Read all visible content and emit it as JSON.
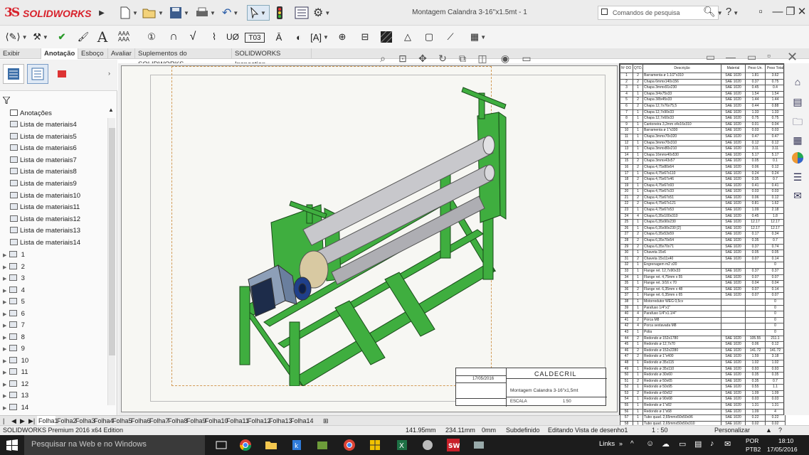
{
  "app": {
    "logo_ds": "3S",
    "logo_name": "SOLIDWORKS",
    "document_title": "Montagem Calandra 3-16''x1.5mt - 1",
    "search_placeholder": "Comandos de pesquisa",
    "help_label": "?",
    "window_controls": {
      "minimize": "—",
      "restore": "❐",
      "close": "✕"
    }
  },
  "ribbon_tabs": [
    {
      "label": "Exibir layout"
    },
    {
      "label": "Anotação",
      "active": true
    },
    {
      "label": "Esboço"
    },
    {
      "label": "Avaliar"
    },
    {
      "label": "Suplementos do SOLIDWORKS"
    },
    {
      "label": "SOLIDWORKS Inspection"
    }
  ],
  "annotation_tools": {
    "text_label": "A",
    "aaa_top": "AAA",
    "aaa_bottom": "AAA",
    "hole_callout": "UØ",
    "tag": "Τ03"
  },
  "left_panel": {
    "annotations_label": "Anotações",
    "bom_items": [
      "Lista de materiais4",
      "Lista de materiais5",
      "Lista de materiais6",
      "Lista de materiais7",
      "Lista de materiais8",
      "Lista de materiais9",
      "Lista de materiais10",
      "Lista de materiais11",
      "Lista de materiais12",
      "Lista de materiais13",
      "Lista de materiais14"
    ],
    "views": [
      "1",
      "2",
      "3",
      "4",
      "5",
      "6",
      "7",
      "8",
      "9",
      "10",
      "11",
      "12",
      "13",
      "14"
    ]
  },
  "sheet_tabs": [
    "Folha1",
    "Folha2",
    "Folha3",
    "Folha4",
    "Folha5",
    "Folha6",
    "Folha7",
    "Folha8",
    "Folha9",
    "Folha10",
    "Folha11",
    "Folha12",
    "Folha13",
    "Folha14"
  ],
  "title_block": {
    "company": "CALDECRIL",
    "title": "Montagem Calandra 3-16\"x1,5mt",
    "scale_label": "ESCALA",
    "scale": "1:50",
    "date": "17/05/2016"
  },
  "bom": {
    "headers": [
      "Nº DO ITEM",
      "QTD.",
      "Descrição",
      "Material",
      "Peso Un.",
      "Peso Total"
    ],
    "rows": [
      [
        "1",
        "2",
        "Barramenta ø 1.1/2\"x310",
        "SAE 1020",
        "1.81",
        "3.62"
      ],
      [
        "2",
        "2",
        "Chapa 6mmx140x156",
        "SAE 1020",
        "0.37",
        "0.75"
      ],
      [
        "3",
        "1",
        "Chapa 3mmx91x230",
        "SAE 1020",
        "0.45",
        "0.4"
      ],
      [
        "4",
        "1",
        "Chapa 3/4x75x33",
        "SAE 1020",
        "1.54",
        "1.54"
      ],
      [
        "5",
        "2",
        "Chapa 3/8x45x33",
        "SAE 1020",
        "1.44",
        "1.44"
      ],
      [
        "6",
        "2",
        "Chapa 12,7x76x75,5",
        "SAE 1020",
        "0.44",
        "0.88"
      ],
      [
        "7",
        "1",
        "Chapa 12,7x90x33",
        "SAE 1020",
        "1.33",
        "1.33"
      ],
      [
        "8",
        "1",
        "Chapa 12,7x60x33",
        "SAE 1020",
        "0.75",
        "0.75"
      ],
      [
        "9",
        "1",
        "Cantoneira 3,2mm x4x16x310",
        "SAE 1020",
        "0.01",
        "0.04"
      ],
      [
        "10",
        "1",
        "Barramenta ø 1\"x330",
        "SAE 1020",
        "0.03",
        "0.03"
      ],
      [
        "11",
        "1",
        "Chapa 3mmx70x320",
        "SAE 1020",
        "0.47",
        "0.47"
      ],
      [
        "12",
        "1",
        "Chapa 3mmx70x310",
        "SAE 1020",
        "0.12",
        "0.12"
      ],
      [
        "13",
        "1",
        "Chapa 3mmx80x210",
        "SAE 1020",
        "3.11",
        "3.11"
      ],
      [
        "14",
        "1",
        "Chapa 16mmx40x530",
        "SAE 1020",
        "5.17",
        "5.17"
      ],
      [
        "15",
        "2",
        "Chapa 3mmx43x57",
        "SAE 1020",
        "0.05",
        "0.1"
      ],
      [
        "16",
        "2",
        "Chapa 4,75x80x64",
        "SAE 1020",
        "0.06",
        "0.12"
      ],
      [
        "17",
        "1",
        "Chapa 4,75x67x110",
        "SAE 1020",
        "0.24",
        "0.24"
      ],
      [
        "18",
        "2",
        "Chapa 4,75x67x46",
        "SAE 1020",
        "0.35",
        "0.7"
      ],
      [
        "19",
        "1",
        "Chapa 4,75x67x93",
        "SAE 1020",
        "0.41",
        "0.41"
      ],
      [
        "20",
        "1",
        "Chapa 4,75x67x33",
        "SAE 1020",
        "0.03",
        "0.03"
      ],
      [
        "21",
        "2",
        "Chapa 4,75x67x51",
        "SAE 1020",
        "0.06",
        "0.12"
      ],
      [
        "22",
        "2",
        "Chapa 4,75x67x121",
        "SAE 1020",
        "0.81",
        "1.62"
      ],
      [
        "23",
        "1",
        "Chapa 4,75x67x53",
        "SAE 1020",
        "1.09",
        "2.18"
      ],
      [
        "24",
        "4",
        "Chapa 6,35x100x310",
        "SAE 1020",
        "0.45",
        "1.8"
      ],
      [
        "25",
        "1",
        "Chapa 6,35x90x230",
        "SAE 1020",
        "12.17",
        "12.17"
      ],
      [
        "26",
        "1",
        "Chapa 6,35x90x230 [2]",
        "SAE 1020",
        "12.17",
        "12.17"
      ],
      [
        "27",
        "2",
        "Chapa 6,35x53x59",
        "SAE 1020",
        "0.17",
        "0.34"
      ],
      [
        "28",
        "2",
        "Chapa 6,35x70x54",
        "SAE 1020",
        "0.35",
        "0.7"
      ],
      [
        "29",
        "2",
        "Chapa 6,35x70x71",
        "SAE 1020",
        "0.37",
        "0.74"
      ],
      [
        "30",
        "1",
        "Chaveta 15x6",
        "SAE 1020",
        "0.05",
        "0.05"
      ],
      [
        "31",
        "2",
        "Chaveta 15x11x40",
        "SAE 1020",
        "0.07",
        "0.14"
      ],
      [
        "32",
        "1",
        "Engrenagem m2 z20",
        "",
        "",
        "0"
      ],
      [
        "33",
        "1",
        "Flange ret. 12,7x90x33",
        "SAE 1020",
        "0.37",
        "0.37"
      ],
      [
        "34",
        "1",
        "Flange ret. 4,75mm x 55",
        "SAE 1020",
        "0.07",
        "0.07"
      ],
      [
        "35",
        "1",
        "Flange ret. 3/16 x 70",
        "SAE 1020",
        "0.04",
        "0.04"
      ],
      [
        "36",
        "2",
        "Flange ret. 6,35mm x 48",
        "SAE 1020",
        "0.07",
        "0.14"
      ],
      [
        "37",
        "1",
        "Flange ret. 6,35mm x 65",
        "SAE 1020",
        "0.07",
        "0.07"
      ],
      [
        "38",
        "1",
        "Motorredutor WEG 0,5cv",
        "",
        "",
        "0"
      ],
      [
        "39",
        "1",
        "Parafuso 1/4\"x1\"",
        "",
        "",
        "0"
      ],
      [
        "40",
        "4",
        "Parafuso 1/4\"x1.1/4\"",
        "",
        "",
        "0"
      ],
      [
        "41",
        "2",
        "Porca M8",
        "",
        "",
        "0"
      ],
      [
        "42",
        "4",
        "Porca sextavada M8",
        "",
        "",
        "0"
      ],
      [
        "43",
        "1",
        "Polia",
        "",
        "",
        "0"
      ],
      [
        "44",
        "2",
        "Redondo ø 152x1780",
        "SAE 1020",
        "105.55",
        "211.1"
      ],
      [
        "45",
        "1",
        "Redondo ø 12,7x70",
        "SAE 1020",
        "0.06",
        "0.12"
      ],
      [
        "46",
        "2",
        "Redondo ø 152x2280",
        "SAE 1020",
        "141.72",
        "141.72"
      ],
      [
        "47",
        "2",
        "Redondo ø 1\"x400",
        "SAE 1020",
        "1.59",
        "3.18"
      ],
      [
        "48",
        "1",
        "Redondo ø 35x115",
        "SAE 1020",
        "1.02",
        "1.02"
      ],
      [
        "49",
        "1",
        "Redondo ø 35x110",
        "SAE 1020",
        "0.93",
        "0.93"
      ],
      [
        "50",
        "1",
        "Redondo ø 30x60",
        "SAE 1020",
        "0.35",
        "0.35"
      ],
      [
        "51",
        "2",
        "Redondo ø 50x65",
        "SAE 1020",
        "0.35",
        "0.7"
      ],
      [
        "52",
        "1",
        "Redondo ø 50x95",
        "SAE 1020",
        "0.55",
        "1.1"
      ],
      [
        "53",
        "2",
        "Redondo ø 60x52",
        "SAE 1020",
        "1.09",
        "1.09"
      ],
      [
        "54",
        "1",
        "Redondo ø 90x68",
        "SAE 1020",
        "0.03",
        "0.03"
      ],
      [
        "55",
        "1",
        "Redondo ø 1\"x82",
        "SAE 1020",
        "1.31",
        "1.31"
      ],
      [
        "56",
        "1",
        "Redondo ø 1\"x68",
        "SAE 1020",
        "1.09",
        "4"
      ],
      [
        "57",
        "1",
        "Tubo quad. 2,65mmx50x50x96",
        "SAE 1020",
        "0.22",
        "0.22"
      ],
      [
        "58",
        "1",
        "Tubo quad. 2,65mmx50x50x310",
        "SAE 1020",
        "0.02",
        "0.02"
      ]
    ]
  },
  "status_bar": {
    "edition": "SOLIDWORKS Premium 2016 x64 Edition",
    "x": "141.95mm",
    "y": "234.11mm",
    "z": "0mm",
    "state": "Subdefinido",
    "mode": "Editando Vista de desenho1",
    "scale": "1 : 50",
    "custom": "Personalizar"
  },
  "taskbar": {
    "search_placeholder": "Pesquisar na Web e no Windows",
    "links": "Links",
    "lang_top": "POR",
    "lang_bottom": "PTB2",
    "time": "18:10",
    "date": "17/05/2016"
  }
}
